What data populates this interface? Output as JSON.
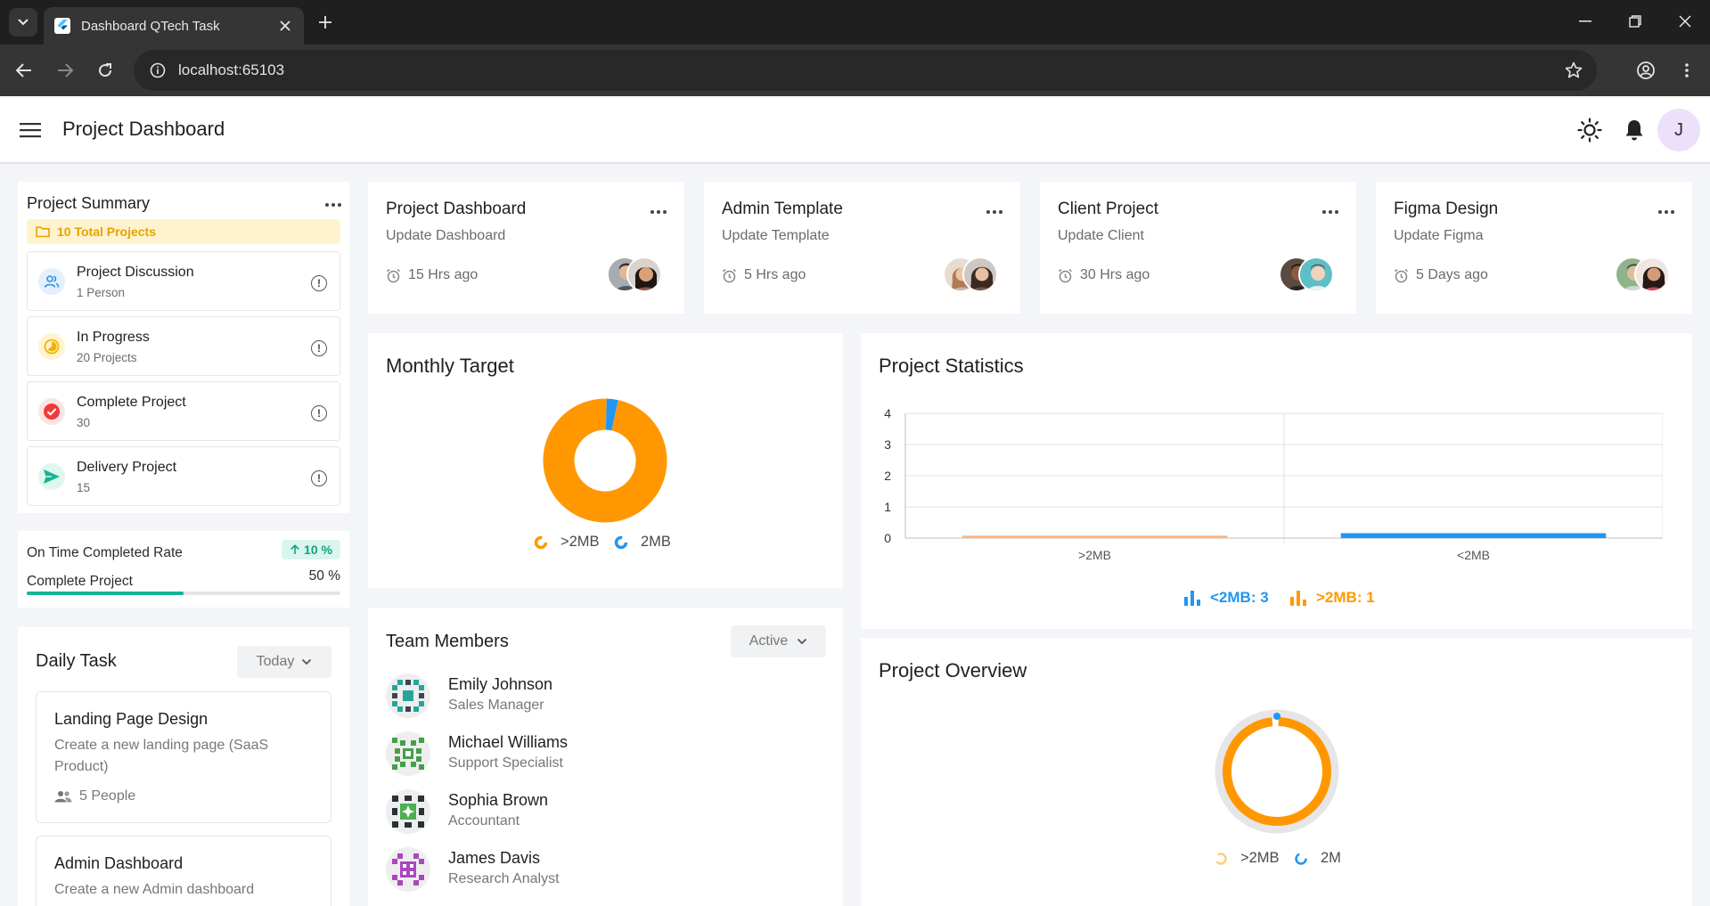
{
  "browser": {
    "tab_title": "Dashboard QTech Task",
    "url": "localhost:65103"
  },
  "appbar": {
    "title": "Project Dashboard",
    "avatar_initial": "J"
  },
  "summary": {
    "title": "Project Summary",
    "total": "10 Total Projects",
    "items": [
      {
        "label": "Project Discussion",
        "sub": "1 Person",
        "icon": "people-icon",
        "color": "#2f8fe0"
      },
      {
        "label": "In Progress",
        "sub": "20 Projects",
        "icon": "progress-icon",
        "color": "#f2b400"
      },
      {
        "label": "Complete Project",
        "sub": "30",
        "icon": "check-circle-icon",
        "color": "#ef3b3b"
      },
      {
        "label": "Delivery Project",
        "sub": "15",
        "icon": "send-icon",
        "color": "#14b391"
      }
    ],
    "alert_glyph": "!"
  },
  "rate": {
    "label": "On Time Completed Rate",
    "badge": "10 %",
    "complete_label": "Complete Project",
    "complete_pct": "50 %",
    "progress": 0.5,
    "color": "#14b391"
  },
  "daily": {
    "title": "Daily Task",
    "filter": "Today",
    "tasks": [
      {
        "title": "Landing Page Design",
        "desc": "Create a new landing page (SaaS Product)",
        "people": "5 People"
      },
      {
        "title": "Admin Dashboard",
        "desc": "Create a new Admin dashboard"
      }
    ]
  },
  "projects": [
    {
      "title": "Project Dashboard",
      "sub": "Update Dashboard",
      "time": "15 Hrs ago"
    },
    {
      "title": "Admin Template",
      "sub": "Update Template",
      "time": "5 Hrs ago"
    },
    {
      "title": "Client Project",
      "sub": "Update Client",
      "time": "30 Hrs ago"
    },
    {
      "title": "Figma Design",
      "sub": "Update Figma",
      "time": "5 Days ago"
    }
  ],
  "monthly": {
    "title": "Monthly Target",
    "legend": [
      ">2MB",
      "2MB"
    ]
  },
  "statistics": {
    "title": "Project Statistics",
    "legend_blue": "<2MB: 3",
    "legend_orange": ">2MB: 1"
  },
  "team": {
    "title": "Team Members",
    "filter": "Active",
    "members": [
      {
        "name": "Emily Johnson",
        "role": "Sales Manager"
      },
      {
        "name": "Michael Williams",
        "role": "Support Specialist"
      },
      {
        "name": "Sophia Brown",
        "role": "Accountant"
      },
      {
        "name": "James Davis",
        "role": "Research Analyst"
      }
    ]
  },
  "overview": {
    "title": "Project Overview",
    "legend": [
      ">2MB",
      "2M"
    ]
  },
  "colors": {
    "orange": "#ff9800",
    "blue": "#2196f3",
    "accent": "#14b391"
  },
  "chart_data": [
    {
      "type": "pie",
      "title": "Monthly Target",
      "categories": [
        ">2MB",
        "2MB"
      ],
      "values": [
        97,
        3
      ]
    },
    {
      "type": "bar",
      "title": "Project Statistics",
      "categories": [
        ">2MB",
        "<2MB"
      ],
      "series": [
        {
          "name": ">2MB",
          "values": [
            0.02,
            0
          ]
        },
        {
          "name": "<2MB",
          "values": [
            0,
            0.1
          ]
        }
      ],
      "ylim": [
        0,
        4
      ],
      "yticks": [
        "0",
        "1",
        "2",
        "3",
        "4"
      ],
      "grid": true
    },
    {
      "type": "pie",
      "title": "Project Overview",
      "categories": [
        ">2MB",
        "2M"
      ],
      "values": [
        99,
        1
      ]
    }
  ]
}
